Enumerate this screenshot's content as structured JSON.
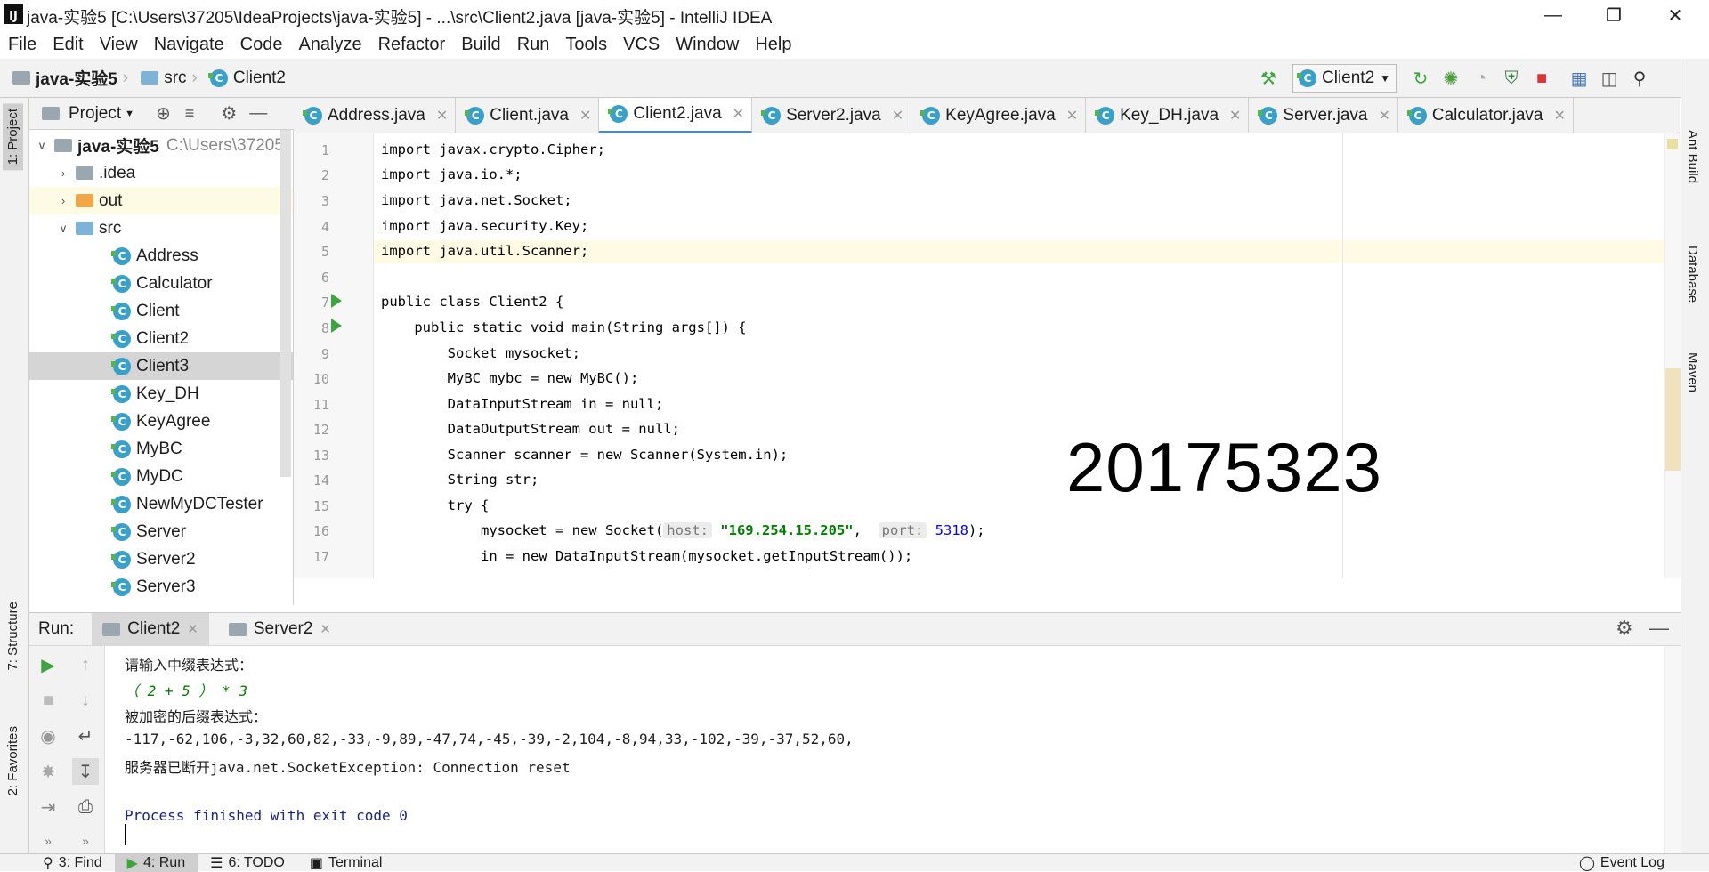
{
  "window": {
    "title": "java-实验5 [C:\\Users\\37205\\IdeaProjects\\java-实验5] - ...\\src\\Client2.java [java-实验5] - IntelliJ IDEA",
    "logo_text": "IJ",
    "minimize_icon": "minimize-icon",
    "restore_icon": "restore-icon",
    "close_icon": "close-icon"
  },
  "menu": [
    "File",
    "Edit",
    "View",
    "Navigate",
    "Code",
    "Analyze",
    "Refactor",
    "Build",
    "Run",
    "Tools",
    "VCS",
    "Window",
    "Help"
  ],
  "breadcrumb": {
    "project": "java-实验5",
    "folder": "src",
    "file": "Client2"
  },
  "run_config": {
    "label": "Client2"
  },
  "project_panel": {
    "title": "Project",
    "root": {
      "name": "java-实验5",
      "path": "C:\\Users\\37205\\"
    },
    "folders": [
      ".idea",
      "out",
      "src"
    ],
    "classes": [
      "Address",
      "Calculator",
      "Client",
      "Client2",
      "Client3",
      "Key_DH",
      "KeyAgree",
      "MyBC",
      "MyDC",
      "NewMyDCTester",
      "Server",
      "Server2",
      "Server3"
    ]
  },
  "editor_tabs": [
    "Address.java",
    "Client.java",
    "Client2.java",
    "Server2.java",
    "KeyAgree.java",
    "Key_DH.java",
    "Server.java",
    "Calculator.java"
  ],
  "active_tab": "Client2.java",
  "line_numbers": [
    "1",
    "2",
    "3",
    "4",
    "5",
    "6",
    "7",
    "8",
    "9",
    "10",
    "11",
    "12",
    "13",
    "14",
    "15",
    "16",
    "17"
  ],
  "code": {
    "l1": "import javax.crypto.Cipher;",
    "l2": "import java.io.*;",
    "l3": "import java.net.Socket;",
    "l4": "import java.security.Key;",
    "l5": "import java.util.Scanner;",
    "l7": "public class Client2 {",
    "l8": "    public static void main(String args[]) {",
    "l9": "        Socket mysocket;",
    "l10": "        MyBC mybc = new MyBC();",
    "l11": "        DataInputStream in = null;",
    "l12": "        DataOutputStream out = null;",
    "l13": "        Scanner scanner = new Scanner(System.in);",
    "l14": "        String str;",
    "l15": "        try {",
    "l16_a": "            mysocket = new Socket(",
    "l16_hint_host": "host:",
    "l16_str": "\"169.254.15.205\"",
    "l16_hint_port": "port:",
    "l16_num": "5318",
    "l16_end": ");",
    "l17": "            in = new DataInputStream(mysocket.getInputStream());"
  },
  "overlay_stamp": "20175323",
  "run_panel": {
    "label": "Run:",
    "tabs": [
      "Client2",
      "Server2"
    ],
    "output": [
      "请输入中缀表达式：",
      "（ 2 + 5 ） * 3",
      "被加密的后缀表达式：",
      "-117,-62,106,-3,32,60,82,-33,-9,89,-47,74,-45,-39,-2,104,-8,94,33,-102,-39,-37,52,60,",
      "服务器已断开java.net.SocketException: Connection reset",
      "",
      "Process finished with exit code 0"
    ]
  },
  "right_tools": [
    "Ant Build",
    "Database",
    "Maven"
  ],
  "left_tools": [
    "1: Project",
    "7: Structure",
    "2: Favorites"
  ],
  "bottom_tools": [
    "3: Find",
    "4: Run",
    "6: TODO",
    "Terminal"
  ],
  "event_log": "Event Log"
}
